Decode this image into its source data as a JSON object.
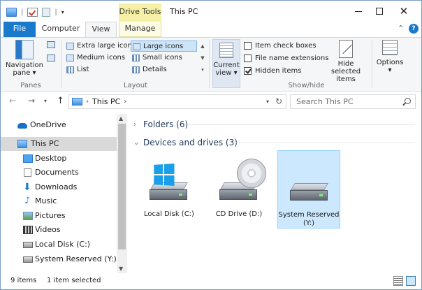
{
  "window": {
    "title": "This PC"
  },
  "quick_access": {
    "separator": "|",
    "dropdown": "▾"
  },
  "contextual_tab": {
    "label": "Drive Tools"
  },
  "window_buttons": {
    "close": "✕"
  },
  "tabs": [
    {
      "label": "File",
      "active": false
    },
    {
      "label": "Computer",
      "active": false
    },
    {
      "label": "View",
      "active": true
    },
    {
      "label": "Manage",
      "active": false
    }
  ],
  "ribbon": {
    "panes": {
      "nav_pane_label": "Navigation",
      "nav_pane_label2": "pane ▾",
      "group_label": "Panes"
    },
    "layout": {
      "group_label": "Layout",
      "options": [
        {
          "label": "Extra large icons",
          "selected": false
        },
        {
          "label": "Large icons",
          "selected": true
        },
        {
          "label": "Medium icons",
          "selected": false
        },
        {
          "label": "Small icons",
          "selected": false
        },
        {
          "label": "List",
          "selected": false
        },
        {
          "label": "Details",
          "selected": false
        }
      ],
      "scroll_up": "▲",
      "scroll_down": "▼",
      "scroll_more": "▾"
    },
    "current_view": {
      "label": "Current",
      "label2": "view ▾"
    },
    "show_hide": {
      "group_label": "Show/hide",
      "checkboxes": [
        {
          "label": "Item check boxes",
          "checked": false
        },
        {
          "label": "File name extensions",
          "checked": false
        },
        {
          "label": "Hidden items",
          "checked": true
        }
      ],
      "hide_selected_label": "Hide selected",
      "hide_selected_label2": "items"
    },
    "options": {
      "label": "Options",
      "label2": "▾"
    },
    "collapse": "⌃",
    "help": "?"
  },
  "address_bar": {
    "back": "←",
    "forward": "→",
    "recent": "▾",
    "up": "↑",
    "path": [
      "This PC"
    ],
    "path_chevron": "›",
    "dropdown": "▾",
    "refresh": "↻",
    "search_placeholder": "Search This PC"
  },
  "sidebar": {
    "items": [
      {
        "label": "OneDrive",
        "icon": "cloud-icon",
        "selected": false
      },
      {
        "label": "This PC",
        "icon": "computer-icon",
        "selected": true
      },
      {
        "label": "Desktop",
        "icon": "desktop-icon",
        "selected": false
      },
      {
        "label": "Documents",
        "icon": "documents-icon",
        "selected": false
      },
      {
        "label": "Downloads",
        "icon": "download-arrow-icon",
        "selected": false
      },
      {
        "label": "Music",
        "icon": "music-note-icon",
        "selected": false
      },
      {
        "label": "Pictures",
        "icon": "pictures-icon",
        "selected": false
      },
      {
        "label": "Videos",
        "icon": "video-icon",
        "selected": false
      },
      {
        "label": "Local Disk (C:)",
        "icon": "drive-icon",
        "selected": false
      },
      {
        "label": "System Reserved (Y:)",
        "icon": "drive-icon",
        "selected": false
      }
    ],
    "download_glyph": "⬇",
    "music_glyph": "♪",
    "scroll_up": "▲",
    "scroll_down": "▼"
  },
  "content": {
    "folders_header": "Folders (6)",
    "devices_header": "Devices and drives (3)",
    "collapsed_chevron": "›",
    "expanded_chevron": "⌄",
    "drives": [
      {
        "label": "Local Disk (C:)",
        "icon": "windows-hard-drive-icon",
        "selected": false
      },
      {
        "label": "CD Drive (D:)",
        "icon": "cd-drive-icon",
        "selected": false
      },
      {
        "label": "System Reserved",
        "label2": "(Y:)",
        "icon": "hard-drive-icon",
        "selected": true
      }
    ]
  },
  "status_bar": {
    "item_count": "9 items",
    "selection": "1 item selected"
  },
  "colors": {
    "file_tab": "#1979ca",
    "drive_tools": "#f5f0a6",
    "selection": "#cce8ff"
  }
}
